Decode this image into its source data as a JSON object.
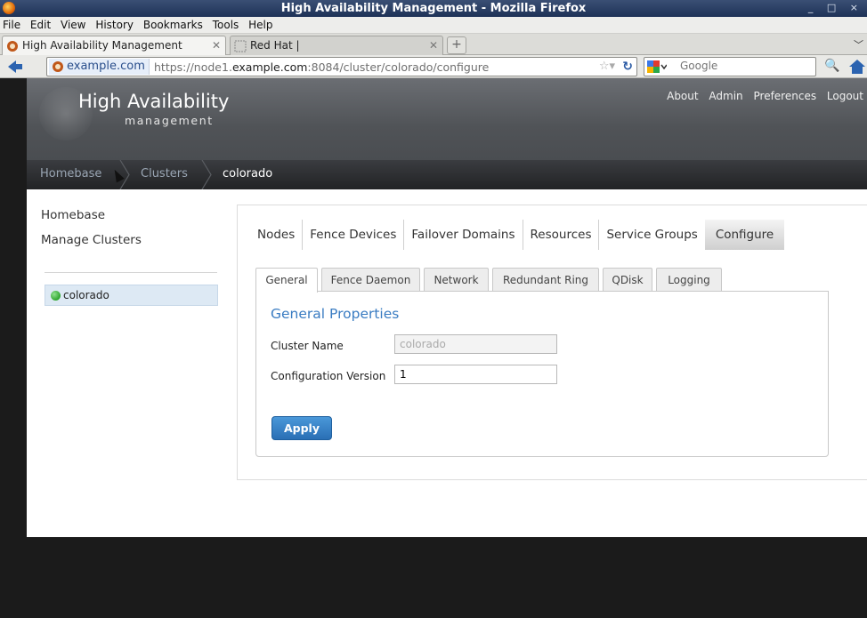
{
  "window": {
    "title": "High Availability Management - Mozilla Firefox",
    "controls": "_ □ ×"
  },
  "menubar": [
    {
      "label": "File"
    },
    {
      "label": "Edit"
    },
    {
      "label": "View"
    },
    {
      "label": "History"
    },
    {
      "label": "Bookmarks"
    },
    {
      "label": "Tools"
    },
    {
      "label": "Help"
    }
  ],
  "tabs": [
    {
      "label": "High Availability Management",
      "close": "✕"
    },
    {
      "label": "Red Hat |",
      "close": "✕"
    }
  ],
  "navbar": {
    "site": "example.com",
    "url_prefix": "https://node1.",
    "url_domain": "example.com",
    "url_suffix": ":8084/cluster/colorado/configure",
    "search_placeholder": "Google"
  },
  "app": {
    "title": "High Availability",
    "subtitle": "management",
    "toplinks": [
      "About",
      "Admin",
      "Preferences",
      "Logout"
    ]
  },
  "breadcrumb": [
    "Homebase",
    "Clusters",
    "colorado"
  ],
  "sidebar": {
    "links": [
      "Homebase",
      "Manage Clusters"
    ],
    "cluster": "colorado",
    "cluster_status_color": "#2ea52e"
  },
  "mainnav": [
    "Nodes",
    "Fence Devices",
    "Failover Domains",
    "Resources",
    "Service Groups",
    "Configure"
  ],
  "subtabs": [
    "General",
    "Fence Daemon",
    "Network",
    "Redundant Ring",
    "QDisk",
    "Logging"
  ],
  "panel": {
    "title": "General Properties",
    "fields": [
      {
        "label": "Cluster Name",
        "value": "colorado"
      },
      {
        "label": "Configuration Version",
        "value": "1"
      }
    ],
    "apply_label": "Apply"
  },
  "colors": {
    "accent": "#3a7cc2",
    "apply": "#2a6fb5"
  }
}
